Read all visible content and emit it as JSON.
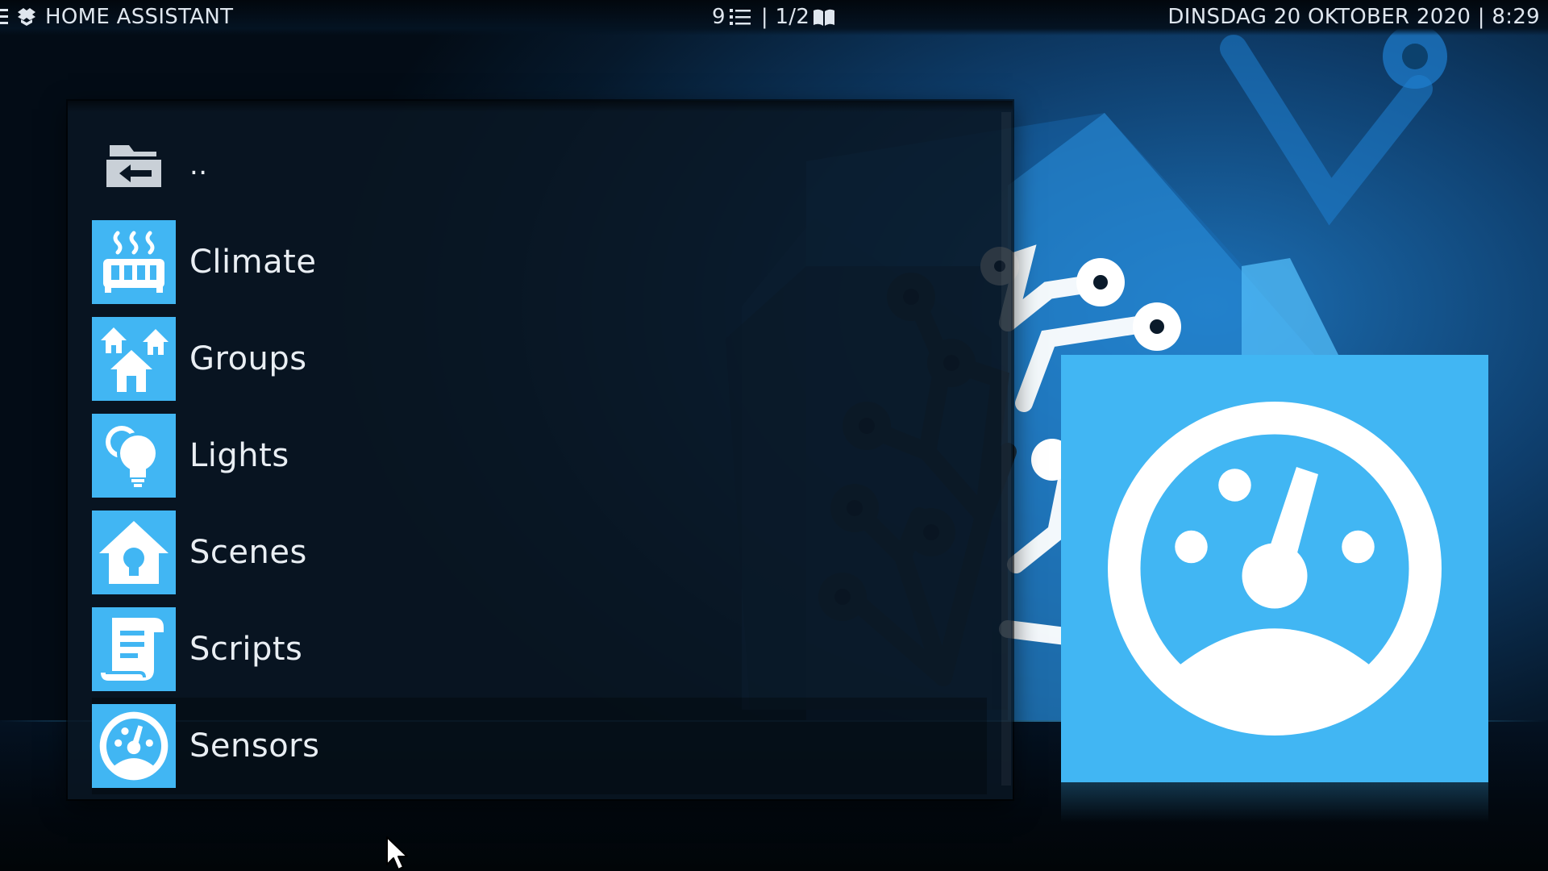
{
  "topbar": {
    "app_title": "HOME ASSISTANT",
    "item_count": "9",
    "page_indicator": "| 1/2",
    "datetime": "DINSDAG 20 OKTOBER 2020 | 8:29"
  },
  "list": {
    "items": [
      {
        "label": "..",
        "icon": "folder-back-icon"
      },
      {
        "label": "Climate",
        "icon": "radiator-icon"
      },
      {
        "label": "Groups",
        "icon": "houses-icon"
      },
      {
        "label": "Lights",
        "icon": "lightbulbs-icon"
      },
      {
        "label": "Scenes",
        "icon": "home-lightbulb-icon"
      },
      {
        "label": "Scripts",
        "icon": "script-icon"
      },
      {
        "label": "Sensors",
        "icon": "gauge-icon"
      }
    ],
    "selected_label": "Sensors"
  },
  "preview": {
    "icon": "gauge-icon"
  },
  "colors": {
    "accent": "#41b6f3",
    "panel": "#091623",
    "background": "#0e3d6b"
  }
}
